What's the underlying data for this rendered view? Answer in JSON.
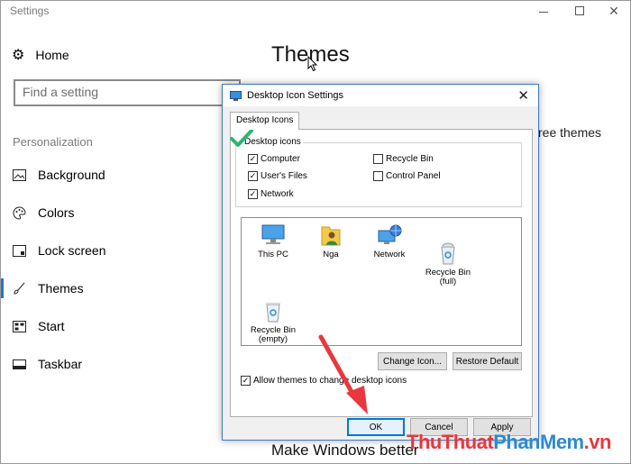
{
  "window": {
    "title": "Settings",
    "minimize_label": "",
    "maximize_label": "",
    "close_label": "✕"
  },
  "sidebar": {
    "home_label": "Home",
    "search_placeholder": "Find a setting",
    "section_label": "Personalization",
    "items": [
      {
        "label": "Background",
        "icon": "image-icon"
      },
      {
        "label": "Colors",
        "icon": "palette-icon"
      },
      {
        "label": "Lock screen",
        "icon": "lock-screen-icon"
      },
      {
        "label": "Themes",
        "icon": "brush-icon",
        "active": true
      },
      {
        "label": "Start",
        "icon": "start-icon"
      },
      {
        "label": "Taskbar",
        "icon": "taskbar-icon"
      }
    ]
  },
  "main": {
    "title": "Themes",
    "side_text": "ree themes",
    "bottom_text": "Make Windows better"
  },
  "dialog": {
    "title": "Desktop Icon Settings",
    "tab_label": "Desktop Icons",
    "group_label": "Desktop icons",
    "checkboxes": [
      {
        "label": "Computer",
        "checked": true
      },
      {
        "label": "Recycle Bin",
        "checked": false
      },
      {
        "label": "User's Files",
        "checked": true
      },
      {
        "label": "Control Panel",
        "checked": false
      },
      {
        "label": "Network",
        "checked": true
      }
    ],
    "icons": [
      {
        "label": "This PC",
        "icon": "computer-icon"
      },
      {
        "label": "Nga",
        "icon": "user-folder-icon"
      },
      {
        "label": "Network",
        "icon": "network-icon"
      },
      {
        "label": "Recycle Bin\n(full)",
        "icon": "recycle-bin-full-icon"
      },
      {
        "label": "Recycle Bin\n(empty)",
        "icon": "recycle-bin-empty-icon"
      }
    ],
    "change_icon_label": "Change Icon...",
    "restore_default_label": "Restore Default",
    "allow_themes_label": "Allow themes to change desktop icons",
    "allow_themes_checked": true,
    "ok_label": "OK",
    "cancel_label": "Cancel",
    "apply_label": "Apply"
  },
  "watermark": {
    "part1": "ThuThuat",
    "part2": "PhanMem",
    "part3": ".vn"
  },
  "colors": {
    "accent": "#0078d7",
    "nav_active": "#2a6fcf",
    "annotation_arrow": "#e8383d",
    "checkmark_green": "#2bb673"
  }
}
